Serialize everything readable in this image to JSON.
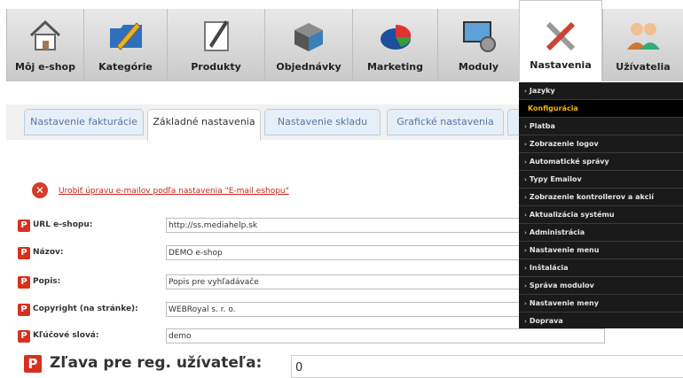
{
  "nav": {
    "items": [
      {
        "label": "Môj e-shop",
        "icon": "home-icon"
      },
      {
        "label": "Kategórie",
        "icon": "folder-pencil-icon"
      },
      {
        "label": "Produkty",
        "icon": "notepad-pencil-icon"
      },
      {
        "label": "Objednávky",
        "icon": "box-icon"
      },
      {
        "label": "Marketing",
        "icon": "pie-chart-icon"
      },
      {
        "label": "Moduly",
        "icon": "monitor-gears-icon"
      },
      {
        "label": "Nastavenia",
        "icon": "tools-icon"
      },
      {
        "label": "Užívatelia",
        "icon": "users-icon"
      }
    ]
  },
  "tabs": [
    {
      "label": "Nastavenie fakturácie"
    },
    {
      "label": "Základné nastavenia"
    },
    {
      "label": "Nastavenie skladu"
    },
    {
      "label": "Grafické nastavenia"
    }
  ],
  "warning": {
    "text": "Urobiť úpravu e-mailov podľa nastavenia \"E-mail eshopu\""
  },
  "form": {
    "badge": "P",
    "fields": [
      {
        "label": "URL e-shopu:",
        "value": "http://ss.mediahelp.sk"
      },
      {
        "label": "Názov:",
        "value": "DEMO e-shop"
      },
      {
        "label": "Popis:",
        "value": "Popis pre vyhľadávače"
      },
      {
        "label": "Copyright (na stránke):",
        "value": "WEBRoyal s. r. o."
      },
      {
        "label": "Kľúčové slová:",
        "value": "demo"
      },
      {
        "label": "Zľava pre reg. užívateľa:",
        "value": "0"
      }
    ]
  },
  "dropdown": {
    "items": [
      "Jazyky",
      "Konfigurácia",
      "Platba",
      "Zobrazenie logov",
      "Automatické správy",
      "Typy Emailov",
      "Zobrazenie kontrollerov a akcií",
      "Aktualizácia systému",
      "Administrácia",
      "Nastavenie menu",
      "Inštalácia",
      "Správa modulov",
      "Nastavenie meny",
      "Doprava"
    ],
    "selected": "Konfigurácia"
  },
  "colors": {
    "accent": "#d8301f",
    "dropdown_bg": "#1a1a1a",
    "dropdown_selected": "#f6b600",
    "tab_text": "#5578a0"
  }
}
